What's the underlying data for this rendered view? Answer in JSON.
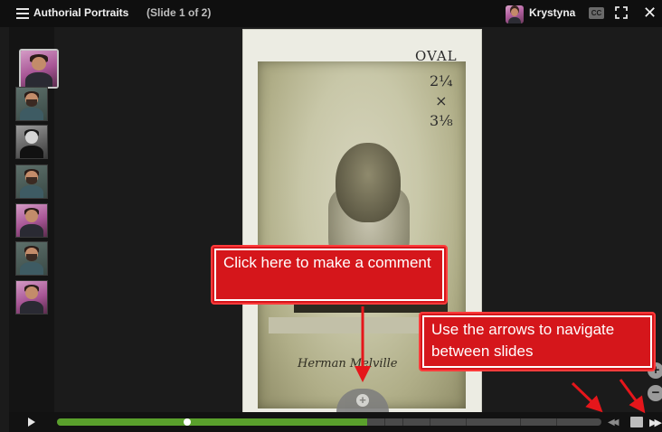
{
  "header": {
    "title": "Authorial Portraits",
    "subtitle": "(Slide 1 of 2)",
    "user_name": "Krystyna",
    "cc_label": "CC"
  },
  "sidebar": {
    "thumbnails": [
      {
        "kind": "woman",
        "active": true
      },
      {
        "kind": "man",
        "active": false
      },
      {
        "kind": "bw",
        "active": false
      },
      {
        "kind": "man",
        "active": false
      },
      {
        "kind": "woman",
        "active": false
      },
      {
        "kind": "man",
        "active": false
      },
      {
        "kind": "woman",
        "active": false
      }
    ]
  },
  "slide": {
    "handwritten_oval": "OVAL",
    "handwritten_dims": "2¼\n×\n3⅛",
    "signature": "Herman Melville"
  },
  "callouts": {
    "comment": "Click here to make a comment",
    "navigate": "Use the arrows to navigate between slides"
  },
  "controls": {
    "progress_fraction": 0.57,
    "knob_fraction": 0.24,
    "zoom_in": "+",
    "zoom_out": "−"
  },
  "colors": {
    "callout_red": "#d5161b",
    "progress_green": "#5aa02c",
    "background": "#1b1b1b"
  }
}
